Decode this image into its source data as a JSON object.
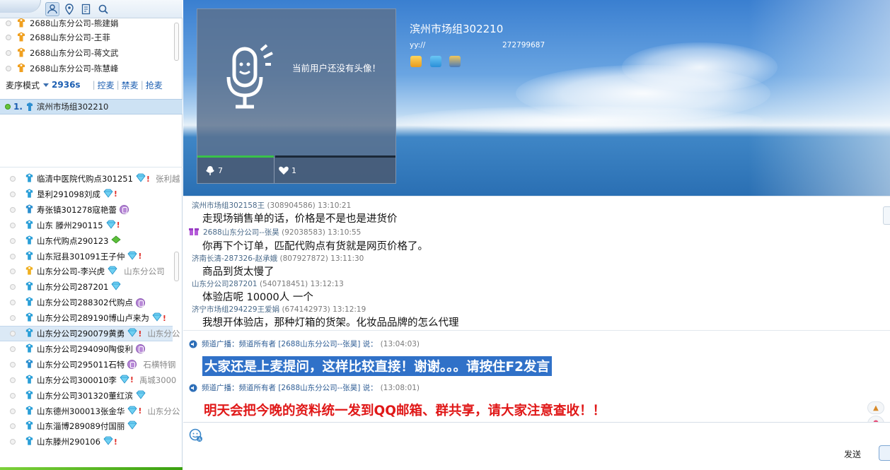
{
  "left": {
    "upper_rows": [
      {
        "text": "2688山东分公司-熊建娟"
      },
      {
        "text": "2688山东分公司-王菲"
      },
      {
        "text": "2688山东分公司-蒋文武"
      },
      {
        "text": "2688山东分公司-陈慧峰"
      }
    ],
    "mic_mode": {
      "label": "麦序模式",
      "time": "2936s",
      "control": "控麦",
      "ban": "禁麦",
      "grab": "抢麦"
    },
    "queue": {
      "index": "1.",
      "name": "滨州市场组302210"
    },
    "users": [
      {
        "name": "临清中医院代购点301251",
        "badge": "gem",
        "mark": "!",
        "extra": "张利越"
      },
      {
        "name": "垦利291098刘成",
        "badge": "gem",
        "mark": "!",
        "extra": ""
      },
      {
        "name": "寿张镇301278寇艳蕾",
        "badge": "purple",
        "mark": "",
        "extra": ""
      },
      {
        "name": "山东    滕州290115",
        "badge": "gem",
        "mark": "!",
        "extra": ""
      },
      {
        "name": "山东代购点290123",
        "badge": "leaf",
        "mark": "",
        "extra": ""
      },
      {
        "name": "山东冠县301091王子仲",
        "badge": "gem",
        "mark": "!",
        "extra": ""
      },
      {
        "name": "山东分公司-李兴虎",
        "badge": "gem",
        "mark": "",
        "extra": "山东分公司"
      },
      {
        "name": "山东分公司287201",
        "badge": "gem",
        "mark": "",
        "extra": ""
      },
      {
        "name": "山东分公司288302代购点",
        "badge": "purple",
        "mark": "",
        "extra": ""
      },
      {
        "name": "山东分公司289190博山卢来为",
        "badge": "gem",
        "mark": "!",
        "extra": ""
      },
      {
        "name": "山东分公司290079黄勇",
        "badge": "gem",
        "mark": "!",
        "extra": "山东分公"
      },
      {
        "name": "山东分公司294090陶俊利",
        "badge": "purple",
        "mark": "",
        "extra": ""
      },
      {
        "name": "山东分公司295011石特",
        "badge": "purple",
        "mark": "",
        "extra": "石横特钢"
      },
      {
        "name": "山东分公司300010李",
        "badge": "gem",
        "mark": "!",
        "extra": "禹城3000"
      },
      {
        "name": "山东分公司301320董红滨",
        "badge": "gem",
        "mark": "",
        "extra": ""
      },
      {
        "name": "山东德州300013张金华",
        "badge": "gem",
        "mark": "!",
        "extra": "山东分公"
      },
      {
        "name": "山东淄博289089付国丽",
        "badge": "gem",
        "mark": "",
        "extra": ""
      },
      {
        "name": "山东滕州290106",
        "badge": "gem",
        "mark": "!",
        "extra": ""
      }
    ]
  },
  "banner": {
    "no_avatar_text": "当前用户还没有头像！",
    "flower_count": "7",
    "heart_count": "1",
    "channel_name": "滨州市场组302210",
    "yy_label": "yy://",
    "yy_id": "272799687"
  },
  "chat": {
    "messages": [
      {
        "sender": "滨州市场组302158王",
        "id": "(308904586)",
        "time": "13:10:21",
        "text": "走现场销售单的话，价格是不是也是进货价"
      },
      {
        "sender": "2688山东分公司--张昊",
        "id": "(92038583)",
        "time": "13:10:55",
        "text": "你再下个订单，匹配代购点有货就是网页价格了。"
      },
      {
        "sender": "济南长清-287326-赵承娥",
        "id": "(807927872)",
        "time": "13:11:30",
        "text": "商品到货太慢了"
      },
      {
        "sender": "山东分公司287201",
        "id": "(540718451)",
        "time": "13:12:13",
        "text": "体验店呢 10000人 一个"
      },
      {
        "sender": "济宁市场组294229王爱娟",
        "id": "(674142973)",
        "time": "13:12:19",
        "text": "我想开体验店，那种灯箱的货架。化妆品品牌的怎么代理"
      }
    ]
  },
  "broadcast": {
    "items": [
      {
        "head": "频道广播：频道所有者 [2688山东分公司--张昊] 说：",
        "time": "(13:04:03)",
        "text": "大家还是上麦提问，这样比较直接！谢谢。。。请按住F2发言"
      },
      {
        "head": "频道广播：频道所有者 [2688山东分公司--张昊] 说：",
        "time": "(13:08:01)",
        "text": "明天会把今晚的资料统一发到QQ邮箱、群共享，请大家注意查收！！"
      }
    ]
  },
  "input": {
    "send_label": "发送"
  },
  "colors": {
    "accent": "#1d5fb2",
    "selected_row": "#dbe9f6",
    "broadcast_highlight": "#3071c8",
    "broadcast_red": "#e01818"
  },
  "icons": [
    "contacts-icon",
    "location-icon",
    "notes-icon",
    "search-icon",
    "role-icon",
    "gem-icon",
    "emoji-icon",
    "flower-icon",
    "heart-icon",
    "speaker-icon"
  ]
}
